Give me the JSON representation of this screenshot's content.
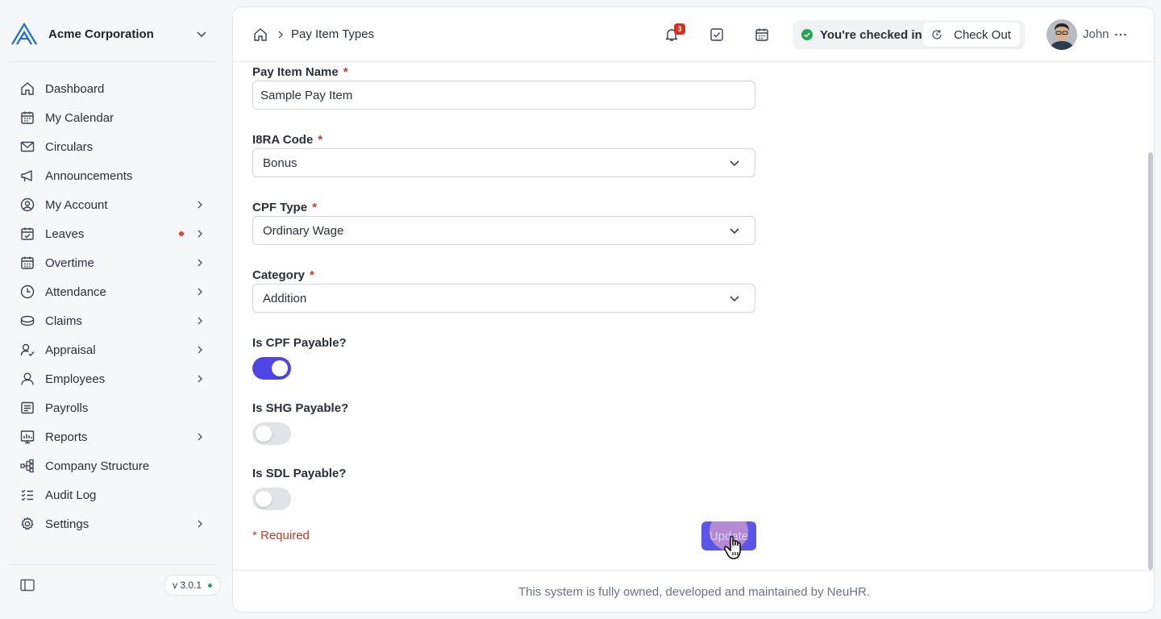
{
  "org": {
    "name": "Acme Corporation",
    "logo_icon": "acme-logo"
  },
  "sidebar": {
    "items": [
      {
        "label": "Dashboard",
        "icon": "home-icon",
        "chevron": false,
        "dot": false
      },
      {
        "label": "My Calendar",
        "icon": "calendar-icon",
        "chevron": false,
        "dot": false
      },
      {
        "label": "Circulars",
        "icon": "mail-icon",
        "chevron": false,
        "dot": false
      },
      {
        "label": "Announcements",
        "icon": "megaphone-icon",
        "chevron": false,
        "dot": false
      },
      {
        "label": "My Account",
        "icon": "user-circle-icon",
        "chevron": true,
        "dot": false
      },
      {
        "label": "Leaves",
        "icon": "calendar-check-icon",
        "chevron": true,
        "dot": true
      },
      {
        "label": "Overtime",
        "icon": "calendar-grid-icon",
        "chevron": true,
        "dot": false
      },
      {
        "label": "Attendance",
        "icon": "clock-icon",
        "chevron": true,
        "dot": false
      },
      {
        "label": "Claims",
        "icon": "coins-icon",
        "chevron": true,
        "dot": false
      },
      {
        "label": "Appraisal",
        "icon": "user-check-icon",
        "chevron": true,
        "dot": false
      },
      {
        "label": "Employees",
        "icon": "user-icon",
        "chevron": true,
        "dot": false
      },
      {
        "label": "Payrolls",
        "icon": "receipt-icon",
        "chevron": false,
        "dot": false
      },
      {
        "label": "Reports",
        "icon": "chart-icon",
        "chevron": true,
        "dot": false
      },
      {
        "label": "Company Structure",
        "icon": "hierarchy-icon",
        "chevron": false,
        "dot": false
      },
      {
        "label": "Audit Log",
        "icon": "checklist-icon",
        "chevron": false,
        "dot": false
      },
      {
        "label": "Settings",
        "icon": "gear-icon",
        "chevron": true,
        "dot": false
      }
    ],
    "version": "v 3.0.1"
  },
  "header": {
    "breadcrumb": "Pay Item Types",
    "notification_count": "3",
    "checkin_status": "You're checked in",
    "checkout_label": "Check Out",
    "user_name": "John"
  },
  "form": {
    "pay_item_name": {
      "label": "Pay Item Name",
      "required_mark": "*",
      "value": "Sample Pay Item"
    },
    "ir8a_code": {
      "label": "I8RA Code",
      "required_mark": "*",
      "value": "Bonus"
    },
    "cpf_type": {
      "label": "CPF Type",
      "required_mark": "*",
      "value": "Ordinary Wage"
    },
    "category": {
      "label": "Category",
      "required_mark": "*",
      "value": "Addition"
    },
    "cpf_payable": {
      "label": "Is CPF Payable?",
      "on": true
    },
    "shg_payable": {
      "label": "Is SHG Payable?",
      "on": false
    },
    "sdl_payable": {
      "label": "Is SDL Payable?",
      "on": false
    },
    "required_note": "* Required",
    "update_label": "Update"
  },
  "footer": {
    "text": "This system is fully owned, developed and maintained by NeuHR."
  },
  "colors": {
    "accent": "#4f46e5",
    "danger": "#d92d20",
    "success": "#22a94f"
  }
}
